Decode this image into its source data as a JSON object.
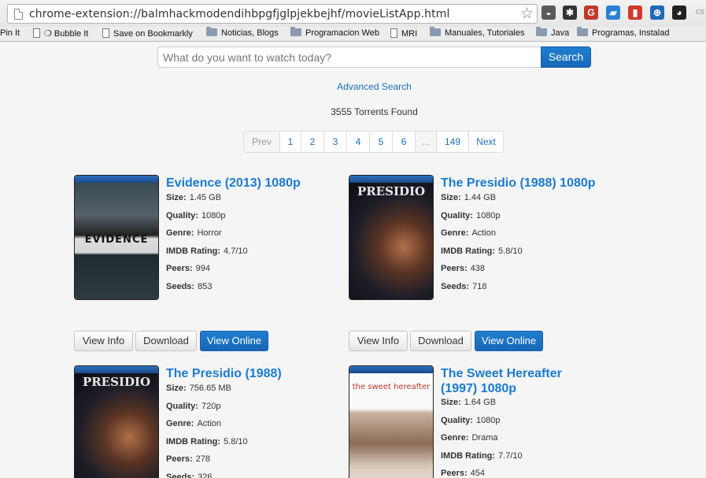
{
  "browser": {
    "url": "chrome-extension://balmhackmodendihbpgfjglpjekbejhf/movieListApp.html",
    "star_glyph": "☆",
    "extensions": [
      {
        "name": "pocket-icon",
        "color": "#5a5a5a",
        "glyph": "◒"
      },
      {
        "name": "puzzle-icon",
        "color": "#333333",
        "glyph": "✱"
      },
      {
        "name": "gradient-icon",
        "color": "#c0392b",
        "glyph": "G"
      },
      {
        "name": "blue-card-icon",
        "color": "#2a7fd4",
        "glyph": "▰"
      },
      {
        "name": "red-badge-icon",
        "color": "#d0392b",
        "glyph": "▮"
      },
      {
        "name": "globe-icon",
        "color": "#1f6bb6",
        "glyph": "⊕"
      },
      {
        "name": "eye-icon",
        "color": "#222222",
        "glyph": "◕"
      }
    ],
    "overflow_label": "cs"
  },
  "bookmarks": [
    {
      "label": "Pin It",
      "icon": "none"
    },
    {
      "label": "❍ Bubble It",
      "icon": "doc"
    },
    {
      "label": "Save on Bookmarkly",
      "icon": "doc"
    },
    {
      "label": "Noticias, Blogs",
      "icon": "folder"
    },
    {
      "label": "Programacion Web",
      "icon": "folder"
    },
    {
      "label": "MRI",
      "icon": "doc"
    },
    {
      "label": "Manuales, Tutoriales",
      "icon": "folder"
    },
    {
      "label": "Java",
      "icon": "folder"
    },
    {
      "label": "Programas, Instalad",
      "icon": "folder"
    }
  ],
  "search": {
    "placeholder": "What do you want to watch today?",
    "button": "Search",
    "advanced": "Advanced Search"
  },
  "results": {
    "found_text": "3555 Torrents Found"
  },
  "pagination": [
    "Prev",
    "1",
    "2",
    "3",
    "4",
    "5",
    "6",
    "...",
    "149",
    "Next"
  ],
  "movie_labels": {
    "size": "Size:",
    "quality": "Quality:",
    "genre": "Genre:",
    "rating": "IMDB Rating:",
    "peers": "Peers:",
    "seeds": "Seeds:",
    "view_info": "View Info",
    "download": "Download",
    "view_online": "View Online"
  },
  "movies": [
    {
      "title": "Evidence (2013) 1080p",
      "title2": "",
      "size": "1.45 GB",
      "quality": "1080p",
      "genre": "Horror",
      "rating": "4.7/10",
      "peers": "994",
      "seeds": "853",
      "poster_text": "EVIDENCE",
      "poster_kind": "evidence"
    },
    {
      "title": "The Presidio (1988) 1080p",
      "title2": "",
      "size": "1.44 GB",
      "quality": "1080p",
      "genre": "Action",
      "rating": "5.8/10",
      "peers": "438",
      "seeds": "718",
      "poster_text": "PRESIDIO",
      "poster_kind": "presidio"
    },
    {
      "title": "The Presidio (1988)",
      "title2": "",
      "size": "756.65 MB",
      "quality": "720p",
      "genre": "Action",
      "rating": "5.8/10",
      "peers": "278",
      "seeds": "326",
      "poster_text": "PRESIDIO",
      "poster_kind": "presidio"
    },
    {
      "title": "The Sweet Hereafter",
      "title2": "(1997) 1080p",
      "size": "1.64 GB",
      "quality": "1080p",
      "genre": "Drama",
      "rating": "7.7/10",
      "peers": "454",
      "seeds": "",
      "poster_text": "the sweet hereafter",
      "poster_kind": "sweet"
    }
  ]
}
